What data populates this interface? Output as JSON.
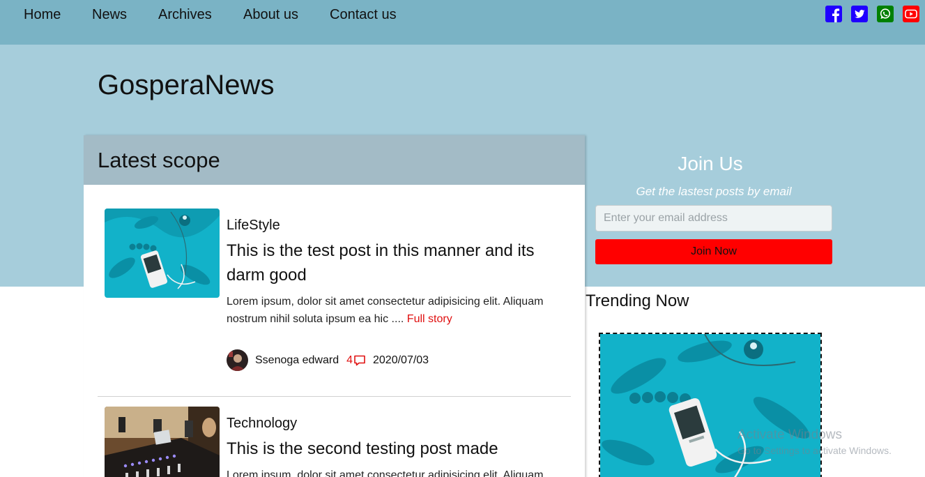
{
  "nav": {
    "links": [
      "Home",
      "News",
      "Archives",
      "About us",
      "Contact us"
    ]
  },
  "social": {
    "icons": [
      "facebook-icon",
      "twitter-icon",
      "whatsapp-icon",
      "youtube-icon"
    ],
    "colors": {
      "facebook": "#1f00ff",
      "twitter": "#1f00ff",
      "whatsapp": "#008000",
      "youtube": "#ff0000"
    }
  },
  "site": {
    "title": "GosperaNews"
  },
  "latest": {
    "heading": "Latest scope",
    "posts": [
      {
        "category": "LifeStyle",
        "title": "This is the test post in this manner and its darm good",
        "excerpt": "Lorem ipsum, dolor sit amet consectetur adipisicing elit. Aliquam nostrum nihil soluta ipsum ea hic ....",
        "read_more": "Full story",
        "author": "Ssenoga edward",
        "comments": "4",
        "date": "2020/07/03"
      },
      {
        "category": "Technology",
        "title": "This is the second testing post made",
        "excerpt": "Lorem ipsum, dolor sit amet consectetur adipisicing elit. Aliquam"
      }
    ]
  },
  "join": {
    "title": "Join Us",
    "subtitle": "Get the lastest posts by email",
    "placeholder": "Enter your email address",
    "button": "Join Now"
  },
  "trending": {
    "heading": "Trending Now"
  },
  "watermark": {
    "line1": "Activate Windows",
    "line2": "Go to Settings to activate Windows."
  },
  "colors": {
    "nav_bg": "#7ab3c5",
    "hero_bg": "#a6cddb",
    "card_header_bg": "#a3bbc6",
    "accent_red": "#ff0000"
  }
}
